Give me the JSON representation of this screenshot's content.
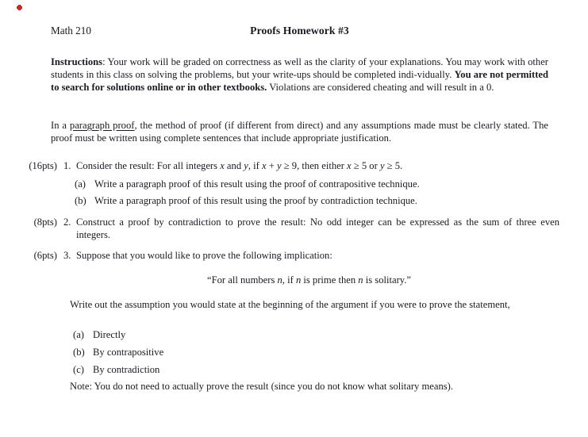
{
  "document": {
    "course": "Math 210",
    "title": "Proofs Homework #3",
    "accent_red": "#dd2222",
    "text_color": "#1a1a22",
    "background": "#ffffff"
  },
  "instructions": {
    "label": "Instructions",
    "colon": ": ",
    "part1": "Your work will be graded on correctness as well as the clarity of your explanations. You may work with other students in this class on solving the problems, but your write-ups should be completed indi-vidually. ",
    "bold_warning": "You are not permitted to search for solutions online or in other textbooks.",
    "part2": " Violations are considered cheating and will result in a 0."
  },
  "paragraph_proof_note": {
    "lead": "In a ",
    "term": "paragraph proof",
    "rest": ", the method of proof (if different from direct) and any assumptions made must be clearly stated. The proof must be written using complete sentences that include appropriate justification."
  },
  "problems": [
    {
      "points": "(16pts)",
      "number": "1.",
      "body_before": "Consider the result: For all integers ",
      "var_x1": "x",
      "mid1": " and ",
      "var_y1": "y",
      "mid2": ", if ",
      "var_x2": "x",
      "mid3": " + ",
      "var_y2": "y",
      "mid4": " ≥ 9, then either ",
      "var_x3": "x",
      "mid5": " ≥ 5 or ",
      "var_y3": "y",
      "mid6": " ≥ 5.",
      "subitems": [
        {
          "label": "(a)",
          "text": "Write a paragraph proof of this result using the proof of contrapositive technique."
        },
        {
          "label": "(b)",
          "text": "Write a paragraph proof of this result using the proof by contradiction technique."
        }
      ]
    },
    {
      "points": "(8pts)",
      "number": "2.",
      "body": "Construct a proof by contradiction to prove the result: No odd integer can be expressed as the sum of three even integers."
    },
    {
      "points": "(6pts)",
      "number": "3.",
      "body": "Suppose that you would like to prove the following implication:",
      "quote_open": "“For all numbers ",
      "quote_var1": "n",
      "quote_mid": ", if ",
      "quote_var2": "n",
      "quote_mid2": " is prime then ",
      "quote_var3": "n",
      "quote_close": " is solitary.”",
      "assumption_text": "Write out the assumption you would state at the beginning of the argument if you were to prove the statement,",
      "subitems": [
        {
          "label": "(a)",
          "text": "Directly"
        },
        {
          "label": "(b)",
          "text": "By contrapositive"
        },
        {
          "label": "(c)",
          "text": "By contradiction"
        }
      ],
      "note": "Note: You do not need to actually prove the result (since you do not know what solitary means)."
    }
  ]
}
